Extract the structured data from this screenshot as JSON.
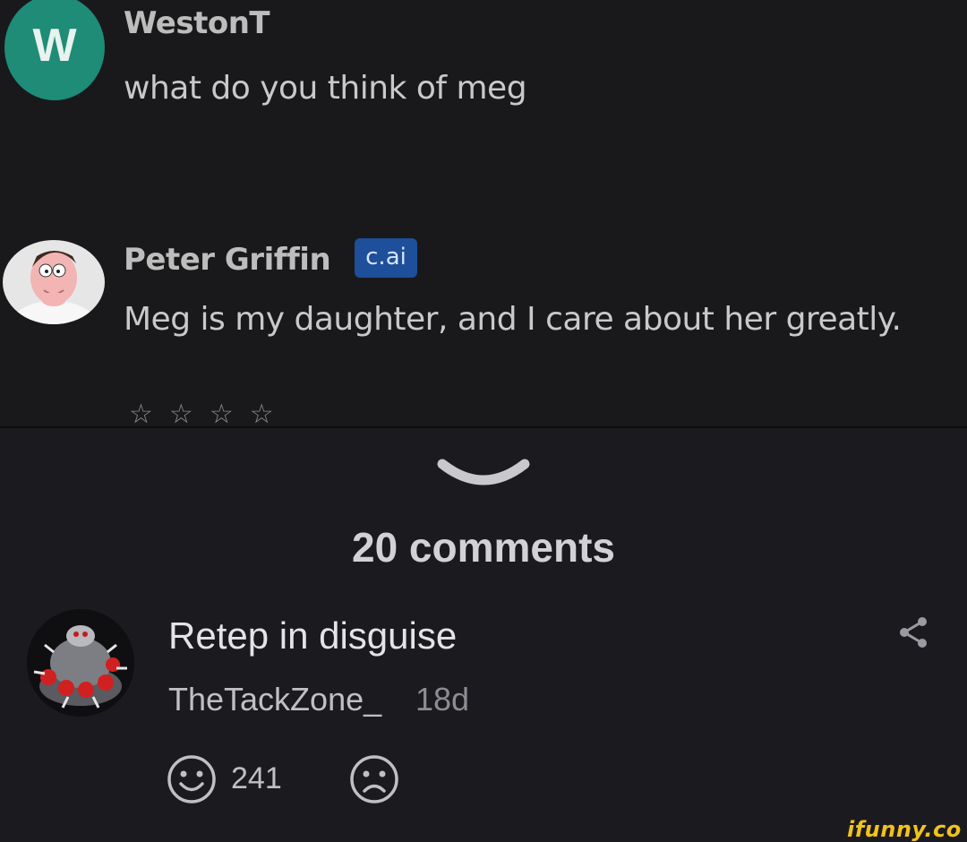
{
  "chat": {
    "user_message": {
      "avatar_letter": "W",
      "avatar_color": "#1e8c76",
      "name": "WestonT",
      "text": "what do you think of meg"
    },
    "bot_message": {
      "avatar_icon": "peter-griffin-avatar",
      "name": "Peter Griffin",
      "badge": "c.ai",
      "badge_color": "#1d4f9a",
      "text": "Meg is my daughter, and I care about her greatly.",
      "rating_stars": [
        "☆",
        "☆",
        "☆",
        "☆"
      ],
      "rating_value": 0
    }
  },
  "comments": {
    "expand_icon": "chevron-down-icon",
    "count_label": "20 comments",
    "items": [
      {
        "avatar_icon": "spiked-machine-avatar",
        "text": "Retep in disguise",
        "username": "TheTackZone_",
        "age": "18d",
        "smile_count": "241",
        "share_icon": "share-icon",
        "smile_icon": "smile-icon",
        "frown_icon": "frown-icon"
      }
    ]
  },
  "watermark": "ifunny.co",
  "colors": {
    "accent_watermark": "#f2c21d",
    "background": "#1b1b1f"
  }
}
